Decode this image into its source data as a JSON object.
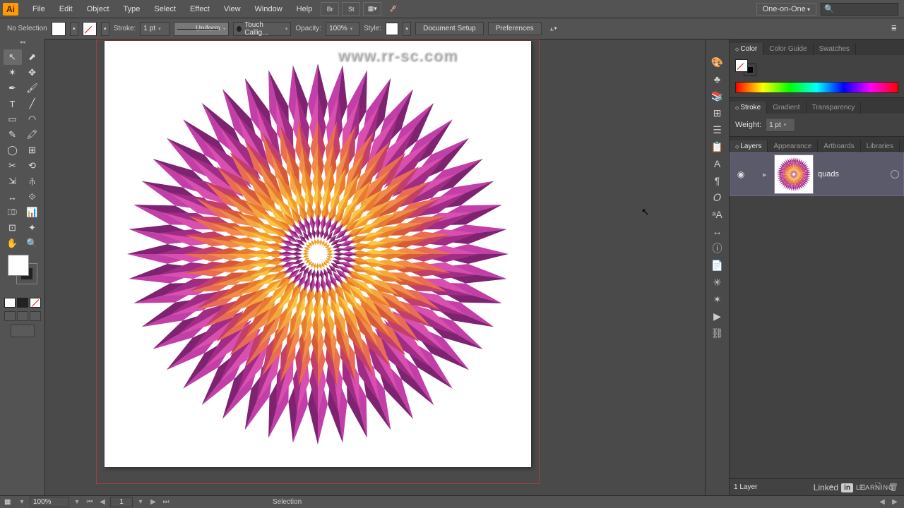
{
  "app": {
    "logo": "Ai"
  },
  "menu": {
    "items": [
      "File",
      "Edit",
      "Object",
      "Type",
      "Select",
      "Effect",
      "View",
      "Window",
      "Help"
    ],
    "shortcut_icons": [
      "Br",
      "St"
    ],
    "workspace": "One-on-One",
    "search_icon": "🔍"
  },
  "control": {
    "selection_state": "No Selection",
    "stroke_label": "Stroke:",
    "stroke_weight": "1 pt",
    "profile": "Uniform",
    "brush": "Touch Callig...",
    "opacity_label": "Opacity:",
    "opacity": "100%",
    "style_label": "Style:",
    "doc_setup": "Document Setup",
    "preferences": "Preferences"
  },
  "tools": {
    "rows": [
      [
        "↖",
        "⬈"
      ],
      [
        "✶",
        "✥"
      ],
      [
        "✒",
        "🖌"
      ],
      [
        "T",
        "╱"
      ],
      [
        "▭",
        "◠"
      ],
      [
        "✎",
        "🖍"
      ],
      [
        "◯",
        "⊞"
      ],
      [
        "✂",
        "⟲"
      ],
      [
        "⇲",
        "⫚"
      ],
      [
        "↔",
        "⟐"
      ],
      [
        "⎄",
        "📊"
      ],
      [
        "⊡",
        "✦"
      ],
      [
        "✋",
        "🔍"
      ]
    ]
  },
  "dock": {
    "icons": [
      "🎨",
      "♣",
      "📚",
      "⊞",
      "☰",
      "📋",
      "A",
      "¶",
      "𝑂",
      "ᵃA",
      "↔",
      "ⓘ",
      "📄",
      "✳",
      "✶",
      "▶",
      "⛓"
    ]
  },
  "panels": {
    "color": {
      "tabs": [
        "Color",
        "Color Guide",
        "Swatches"
      ],
      "active": 0
    },
    "stroke": {
      "tabs": [
        "Stroke",
        "Gradient",
        "Transparency"
      ],
      "active": 0,
      "weight_label": "Weight:",
      "weight": "1 pt"
    },
    "layers": {
      "tabs": [
        "Layers",
        "Appearance",
        "Artboards",
        "Libraries"
      ],
      "active": 0,
      "items": [
        {
          "name": "quads",
          "visible": true
        }
      ],
      "footer_count": "1 Layer"
    }
  },
  "status": {
    "zoom": "100%",
    "artboard_index": "1",
    "tool_name": "Selection"
  },
  "watermark": "www.rr-sc.com",
  "branding": {
    "text1": "Linked",
    "box": "in",
    "text2": "LEARNING"
  }
}
